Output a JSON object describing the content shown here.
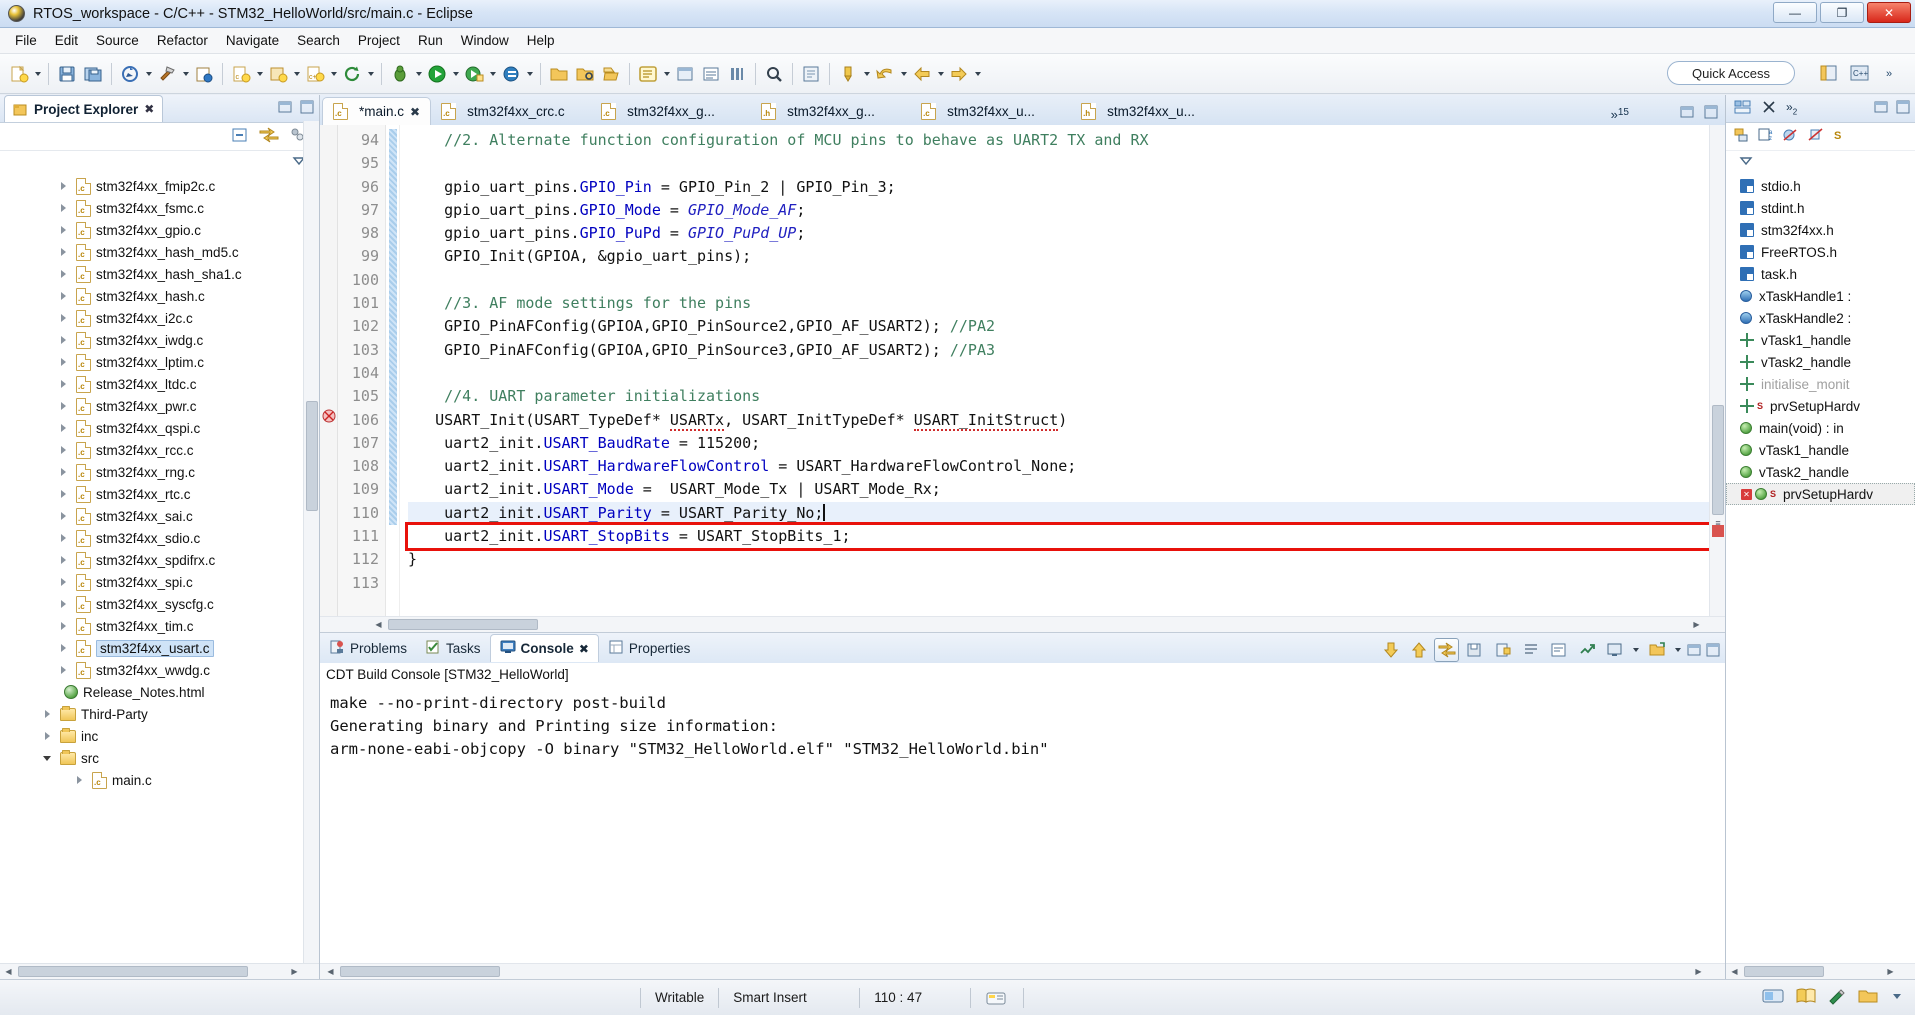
{
  "window": {
    "title": "RTOS_workspace - C/C++ - STM32_HelloWorld/src/main.c - Eclipse",
    "minimize_label": "—",
    "maximize_label": "❐",
    "close_label": "✕"
  },
  "menubar": {
    "items": [
      "File",
      "Edit",
      "Source",
      "Refactor",
      "Navigate",
      "Search",
      "Project",
      "Run",
      "Window",
      "Help"
    ]
  },
  "toolbar": {
    "quick_access_label": "Quick Access",
    "icons": [
      "new-wizard-icon",
      "save-icon",
      "save-all-icon",
      "build-all-icon",
      "build-hammer-icon",
      "toggle-breakpoint-icon",
      "new-c-class-icon",
      "new-c-project-icon",
      "new-c-file-icon",
      "refresh-icon",
      "debug-icon",
      "run-icon",
      "external-tools-icon",
      "profile-icon",
      "open-folder-icon",
      "open-type-icon",
      "search-icon",
      "next-annotation-icon",
      "marker-icon",
      "previous-edit-icon",
      "next-edit-icon",
      "back-icon",
      "forward-icon"
    ]
  },
  "project_explorer": {
    "tab_label": "Project Explorer",
    "tab_close": "✖",
    "toolbar_icons": [
      "collapse-all-icon",
      "link-with-editor-icon",
      "view-menu-icon",
      "view-dropdown-icon"
    ],
    "items": [
      {
        "label": "stm32f4xx_fmip2c.c",
        "type": "c",
        "expandable": true
      },
      {
        "label": "stm32f4xx_fsmc.c",
        "type": "c",
        "expandable": true
      },
      {
        "label": "stm32f4xx_gpio.c",
        "type": "c",
        "expandable": true
      },
      {
        "label": "stm32f4xx_hash_md5.c",
        "type": "c",
        "expandable": true
      },
      {
        "label": "stm32f4xx_hash_sha1.c",
        "type": "c",
        "expandable": true
      },
      {
        "label": "stm32f4xx_hash.c",
        "type": "c",
        "expandable": true
      },
      {
        "label": "stm32f4xx_i2c.c",
        "type": "c",
        "expandable": true
      },
      {
        "label": "stm32f4xx_iwdg.c",
        "type": "c",
        "expandable": true
      },
      {
        "label": "stm32f4xx_lptim.c",
        "type": "c",
        "expandable": true
      },
      {
        "label": "stm32f4xx_ltdc.c",
        "type": "c",
        "expandable": true
      },
      {
        "label": "stm32f4xx_pwr.c",
        "type": "c",
        "expandable": true
      },
      {
        "label": "stm32f4xx_qspi.c",
        "type": "c",
        "expandable": true
      },
      {
        "label": "stm32f4xx_rcc.c",
        "type": "c",
        "expandable": true
      },
      {
        "label": "stm32f4xx_rng.c",
        "type": "c",
        "expandable": true
      },
      {
        "label": "stm32f4xx_rtc.c",
        "type": "c",
        "expandable": true
      },
      {
        "label": "stm32f4xx_sai.c",
        "type": "c",
        "expandable": true
      },
      {
        "label": "stm32f4xx_sdio.c",
        "type": "c",
        "expandable": true
      },
      {
        "label": "stm32f4xx_spdifrx.c",
        "type": "c",
        "expandable": true
      },
      {
        "label": "stm32f4xx_spi.c",
        "type": "c",
        "expandable": true
      },
      {
        "label": "stm32f4xx_syscfg.c",
        "type": "c",
        "expandable": true
      },
      {
        "label": "stm32f4xx_tim.c",
        "type": "c",
        "expandable": true
      },
      {
        "label": "stm32f4xx_usart.c",
        "type": "c",
        "expandable": true,
        "highlighted": true
      },
      {
        "label": "stm32f4xx_wwdg.c",
        "type": "c",
        "expandable": true
      },
      {
        "label": "Release_Notes.html",
        "type": "html",
        "expandable": false
      },
      {
        "label": "Third-Party",
        "type": "folder",
        "expandable": true,
        "indent": 1
      },
      {
        "label": "inc",
        "type": "folder",
        "expandable": true,
        "indent": 1
      },
      {
        "label": "src",
        "type": "folder",
        "expandable": true,
        "expanded": true,
        "indent": 1
      },
      {
        "label": "main.c",
        "type": "c",
        "expandable": true,
        "indent": 3
      }
    ]
  },
  "editor": {
    "tabs": [
      {
        "label": "*main.c",
        "ext": "c",
        "active": true,
        "close": "✖"
      },
      {
        "label": "stm32f4xx_crc.c",
        "ext": "c",
        "active": false
      },
      {
        "label": "stm32f4xx_g...",
        "ext": "c",
        "active": false
      },
      {
        "label": "stm32f4xx_g...",
        "ext": "h",
        "active": false
      },
      {
        "label": "stm32f4xx_u...",
        "ext": "c",
        "active": false
      },
      {
        "label": "stm32f4xx_u...",
        "ext": "h",
        "active": false
      }
    ],
    "overflow_indicator": "»",
    "overflow_count": "15",
    "first_line_number": 94,
    "lines": [
      {
        "n": 94,
        "tokens": [
          {
            "t": "    //2. Alternate function configuration of MCU pins to behave as UART2 TX and RX",
            "c": "cm"
          }
        ]
      },
      {
        "n": 95,
        "tokens": [
          {
            "t": "",
            "c": ""
          }
        ]
      },
      {
        "n": 96,
        "tokens": [
          {
            "t": "    gpio_uart_pins.",
            "c": ""
          },
          {
            "t": "GPIO_Pin",
            "c": "fld"
          },
          {
            "t": " = GPIO_Pin_2 | GPIO_Pin_3;",
            "c": ""
          }
        ]
      },
      {
        "n": 97,
        "tokens": [
          {
            "t": "    gpio_uart_pins.",
            "c": ""
          },
          {
            "t": "GPIO_Mode",
            "c": "fld"
          },
          {
            "t": " = ",
            "c": ""
          },
          {
            "t": "GPIO_Mode_AF",
            "c": "ital"
          },
          {
            "t": ";",
            "c": ""
          }
        ]
      },
      {
        "n": 98,
        "tokens": [
          {
            "t": "    gpio_uart_pins.",
            "c": ""
          },
          {
            "t": "GPIO_PuPd",
            "c": "fld"
          },
          {
            "t": " = ",
            "c": ""
          },
          {
            "t": "GPIO_PuPd_UP",
            "c": "ital"
          },
          {
            "t": ";",
            "c": ""
          }
        ]
      },
      {
        "n": 99,
        "tokens": [
          {
            "t": "    GPIO_Init(GPIOA, &gpio_uart_pins);",
            "c": ""
          }
        ]
      },
      {
        "n": 100,
        "tokens": [
          {
            "t": "",
            "c": ""
          }
        ]
      },
      {
        "n": 101,
        "tokens": [
          {
            "t": "    //3. AF mode settings for the pins",
            "c": "cm"
          }
        ]
      },
      {
        "n": 102,
        "tokens": [
          {
            "t": "    GPIO_PinAFConfig(GPIOA,GPIO_PinSource2,GPIO_AF_USART2); ",
            "c": ""
          },
          {
            "t": "//PA2",
            "c": "cm"
          }
        ]
      },
      {
        "n": 103,
        "tokens": [
          {
            "t": "    GPIO_PinAFConfig(GPIOA,GPIO_PinSource3,GPIO_AF_USART2); ",
            "c": ""
          },
          {
            "t": "//PA3",
            "c": "cm"
          }
        ]
      },
      {
        "n": 104,
        "tokens": [
          {
            "t": "",
            "c": ""
          }
        ]
      },
      {
        "n": 105,
        "tokens": [
          {
            "t": "    //4. UART parameter initializations",
            "c": "cm"
          }
        ]
      },
      {
        "n": 106,
        "tokens": [
          {
            "t": "   USART_Init(USART_TypeDef* ",
            "c": ""
          },
          {
            "t": "USARTx",
            "c": "squig"
          },
          {
            "t": ", USART_InitTypeDef* ",
            "c": ""
          },
          {
            "t": "USART_InitStruct",
            "c": "squig"
          },
          {
            "t": ")",
            "c": ""
          }
        ],
        "marker": "error-warning-marker"
      },
      {
        "n": 107,
        "tokens": [
          {
            "t": "    uart2_init.",
            "c": ""
          },
          {
            "t": "USART_BaudRate",
            "c": "fld"
          },
          {
            "t": " = 115200;",
            "c": ""
          }
        ]
      },
      {
        "n": 108,
        "tokens": [
          {
            "t": "    uart2_init.",
            "c": ""
          },
          {
            "t": "USART_HardwareFlowControl",
            "c": "fld"
          },
          {
            "t": " = USART_HardwareFlowControl_None;",
            "c": ""
          }
        ]
      },
      {
        "n": 109,
        "tokens": [
          {
            "t": "    uart2_init.",
            "c": ""
          },
          {
            "t": "USART_Mode",
            "c": "fld"
          },
          {
            "t": " =  USART_Mode_Tx | USART_Mode_Rx;",
            "c": ""
          }
        ]
      },
      {
        "n": 110,
        "tokens": [
          {
            "t": "    uart2_init.",
            "c": ""
          },
          {
            "t": "USART_Parity",
            "c": "fld"
          },
          {
            "t": " = USART_Parity_No;",
            "c": ""
          }
        ],
        "current": true
      },
      {
        "n": 111,
        "tokens": [
          {
            "t": "    uart2_init.",
            "c": ""
          },
          {
            "t": "USART_StopBits",
            "c": "fld"
          },
          {
            "t": " = USART_StopBits_1;",
            "c": ""
          }
        ],
        "boxed": true
      },
      {
        "n": 112,
        "tokens": [
          {
            "t": "}",
            "c": ""
          }
        ]
      },
      {
        "n": 113,
        "tokens": [
          {
            "t": "",
            "c": ""
          }
        ]
      }
    ]
  },
  "console": {
    "tabs": [
      {
        "label": "Problems",
        "icon": "problems-icon",
        "active": false
      },
      {
        "label": "Tasks",
        "icon": "tasks-icon",
        "active": false
      },
      {
        "label": "Console",
        "icon": "console-icon",
        "active": true,
        "close": "✖"
      },
      {
        "label": "Properties",
        "icon": "properties-icon",
        "active": false
      }
    ],
    "subtitle": "CDT Build Console [STM32_HelloWorld]",
    "toolbar_icons": [
      "scroll-down-icon",
      "scroll-up-icon",
      "scroll-lock-icon",
      "save-console-icon",
      "lock-console-icon",
      "clear-console-icon",
      "wrap-icon",
      "pin-console-icon",
      "display-console-icon",
      "open-console-icon",
      "open-console-dropdown-icon",
      "minimize-icon",
      "maximize-icon"
    ],
    "output": [
      "make --no-print-directory post-build",
      "Generating binary and Printing size information:",
      "arm-none-eabi-objcopy -O binary \"STM32_HelloWorld.elf\" \"STM32_HelloWorld.bin\""
    ]
  },
  "outline": {
    "toolbar_icons": [
      "sort-icon",
      "hide-fields-icon",
      "hide-static-icon",
      "hide-nonpublic-icon",
      "view-menu-icon"
    ],
    "items": [
      {
        "label": "stdio.h",
        "icon": "include-icon"
      },
      {
        "label": "stdint.h",
        "icon": "include-icon"
      },
      {
        "label": "stm32f4xx.h",
        "icon": "include-icon"
      },
      {
        "label": "FreeRTOS.h",
        "icon": "include-icon"
      },
      {
        "label": "task.h",
        "icon": "include-icon"
      },
      {
        "label": "xTaskHandle1 :",
        "icon": "variable-icon"
      },
      {
        "label": "xTaskHandle2 :",
        "icon": "variable-icon"
      },
      {
        "label": "vTask1_handle",
        "icon": "prototype-icon"
      },
      {
        "label": "vTask2_handle",
        "icon": "prototype-icon"
      },
      {
        "label": "initialise_monit",
        "icon": "prototype-icon",
        "dim": true
      },
      {
        "label": "prvSetupHardv",
        "icon": "prototype-icon",
        "static": true
      },
      {
        "label": "main(void) : in",
        "icon": "function-icon"
      },
      {
        "label": "vTask1_handle",
        "icon": "function-icon"
      },
      {
        "label": "vTask2_handle",
        "icon": "function-icon"
      },
      {
        "label": "prvSetupHardv",
        "icon": "function-icon",
        "static": true,
        "error": true,
        "selected": true
      }
    ]
  },
  "statusbar": {
    "writable": "Writable",
    "insert_mode": "Smart Insert",
    "position": "110 : 47",
    "icons": [
      "keyboard-indicator-icon",
      "build-status-icon",
      "book-icon",
      "pencil-icon",
      "folder-status-icon",
      "dropdown-icon"
    ]
  }
}
